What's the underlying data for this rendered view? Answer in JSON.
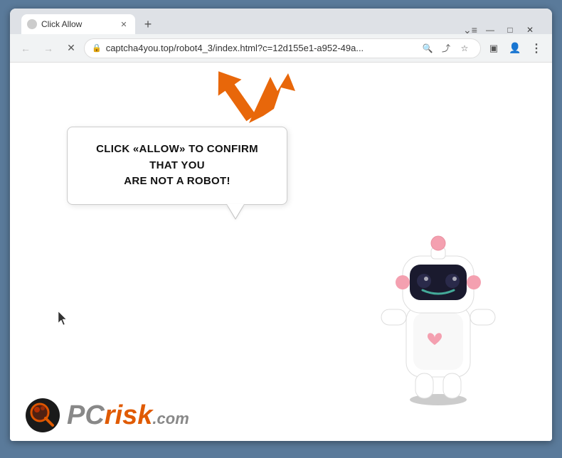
{
  "browser": {
    "tab": {
      "title": "Click Allow",
      "favicon_color": "#cccccc"
    },
    "new_tab_label": "+",
    "controls": {
      "minimize": "—",
      "maximize": "□",
      "close": "✕"
    },
    "nav": {
      "back": "←",
      "forward": "→",
      "reload": "✕",
      "url": "captcha4you.top/robot4_3/index.html?c=12d155e1-a952-49a...",
      "search_icon": "🔍",
      "share_icon": "⤴",
      "star_icon": "☆",
      "extension_icon": "□",
      "profile_icon": "👤",
      "menu_icon": "⋮"
    }
  },
  "page": {
    "bubble_text_line1": "CLICK «ALLOW» TO CONFIRM THAT YOU",
    "bubble_text_line2": "ARE NOT A ROBOT!",
    "arrow_color": "#E8670A"
  },
  "logo": {
    "pc_text": "PC",
    "risk_text": "risk",
    "com_text": ".com"
  }
}
